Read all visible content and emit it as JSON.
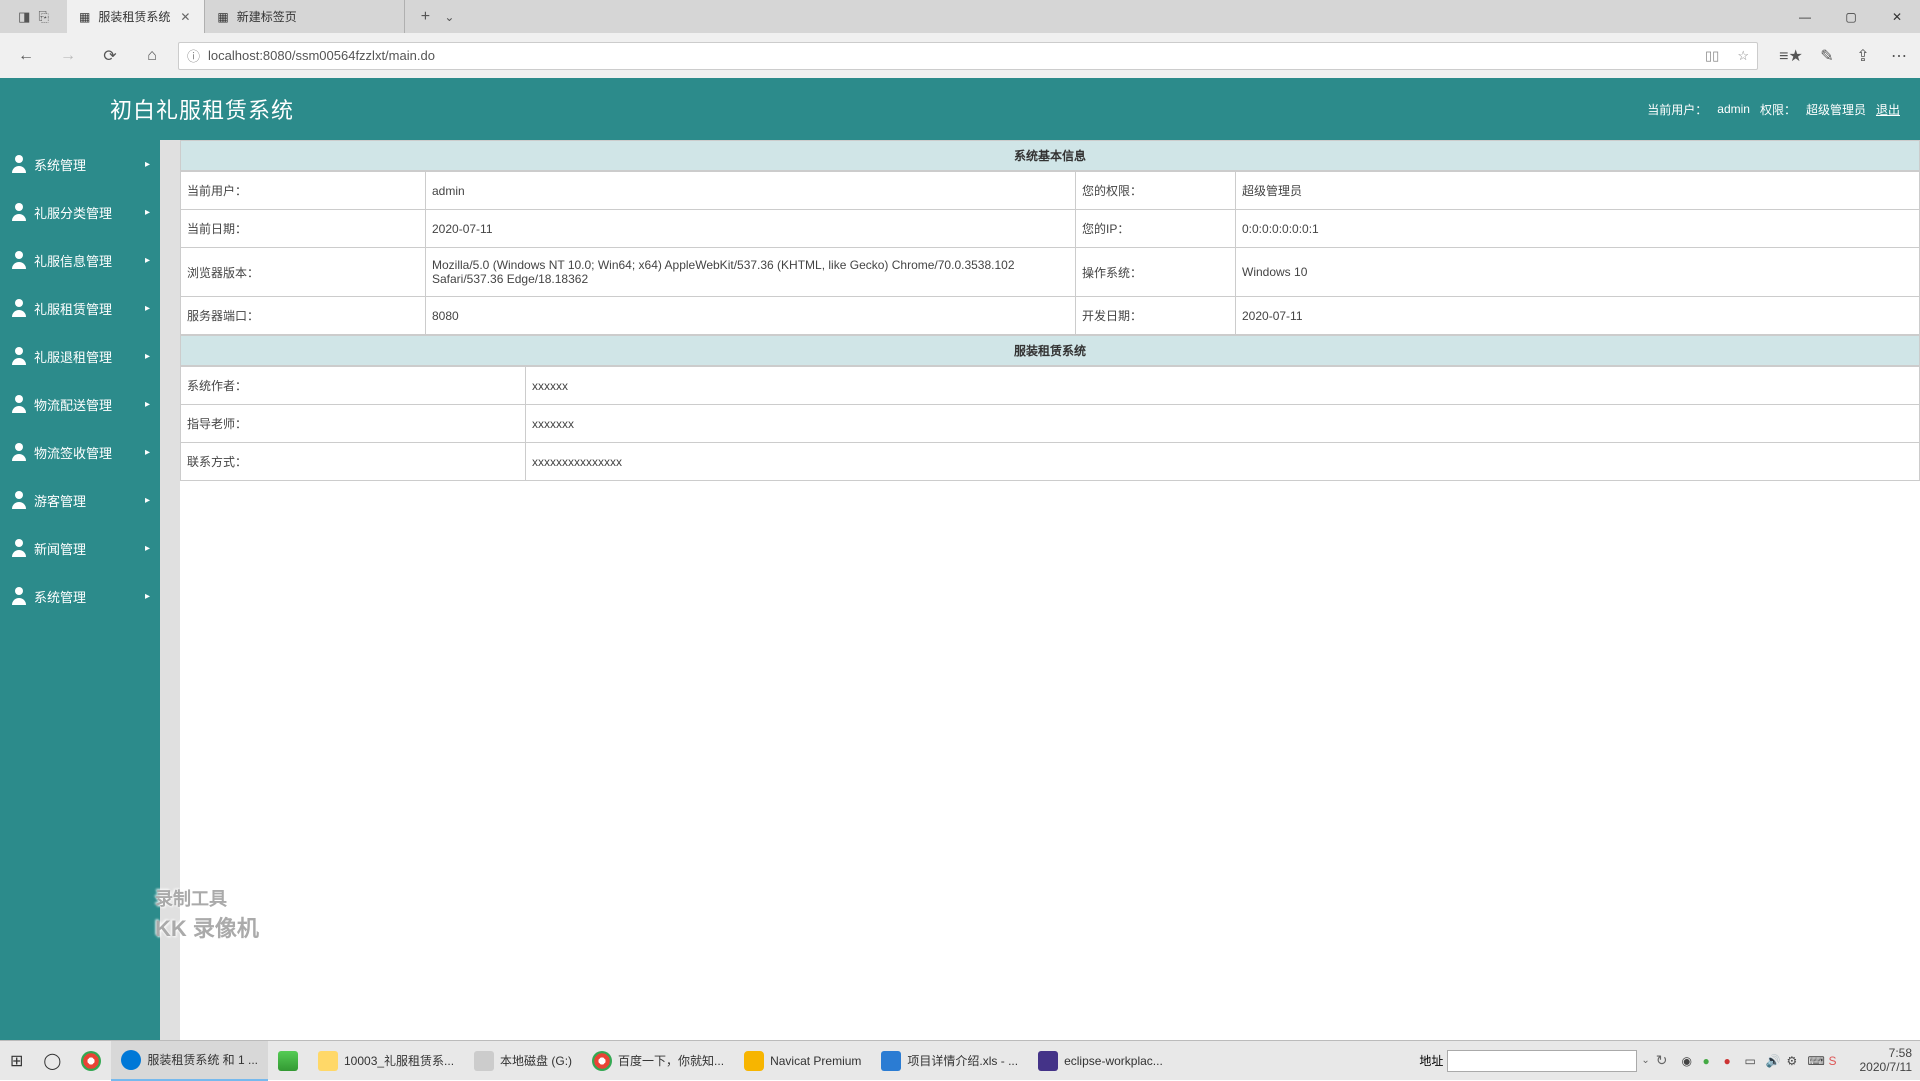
{
  "browser": {
    "tabs": [
      {
        "label": "服装租赁系统",
        "active": true
      },
      {
        "label": "新建标签页",
        "active": false
      }
    ],
    "url": "localhost:8080/ssm00564fzzlxt/main.do",
    "url_prefix_icon": "ⓘ"
  },
  "app": {
    "title": "初白礼服租赁系统",
    "header_user_label": "当前用户：",
    "header_user": "admin",
    "header_role_label": "权限：",
    "header_role": "超级管理员",
    "logout": "退出"
  },
  "sidebar": [
    {
      "label": "系统管理"
    },
    {
      "label": "礼服分类管理"
    },
    {
      "label": "礼服信息管理"
    },
    {
      "label": "礼服租赁管理"
    },
    {
      "label": "礼服退租管理"
    },
    {
      "label": "物流配送管理"
    },
    {
      "label": "物流签收管理"
    },
    {
      "label": "游客管理"
    },
    {
      "label": "新闻管理"
    },
    {
      "label": "系统管理"
    }
  ],
  "panel1": {
    "title": "系统基本信息",
    "rows": [
      {
        "l1": "当前用户：",
        "v1": "admin",
        "l2": "您的权限：",
        "v2": "超级管理员"
      },
      {
        "l1": "当前日期：",
        "v1": "2020-07-11",
        "l2": "您的IP：",
        "v2": "0:0:0:0:0:0:0:1"
      },
      {
        "l1": "浏览器版本：",
        "v1": "Mozilla/5.0 (Windows NT 10.0; Win64; x64) AppleWebKit/537.36 (KHTML, like Gecko) Chrome/70.0.3538.102 Safari/537.36 Edge/18.18362",
        "l2": "操作系统：",
        "v2": "Windows 10"
      },
      {
        "l1": "服务器端口：",
        "v1": "8080",
        "l2": "开发日期：",
        "v2": "2020-07-11"
      }
    ]
  },
  "panel2": {
    "title": "服装租赁系统",
    "rows": [
      {
        "l1": "系统作者：",
        "v1": "xxxxxx"
      },
      {
        "l1": "指导老师：",
        "v1": "xxxxxxx"
      },
      {
        "l1": "联系方式：",
        "v1": "xxxxxxxxxxxxxxx"
      }
    ]
  },
  "watermark": {
    "line1": "录制工具",
    "line2": "KK 录像机"
  },
  "taskbar": {
    "items": [
      {
        "label": "服装租赁系统 和 1 ...",
        "cls": "edge",
        "active": true
      },
      {
        "label": "",
        "cls": "rec",
        "active": false
      },
      {
        "label": "10003_礼服租赁系...",
        "cls": "folder",
        "active": false
      },
      {
        "label": "本地磁盘 (G:)",
        "cls": "disk",
        "active": false
      },
      {
        "label": "百度一下，你就知...",
        "cls": "chrome",
        "active": false
      },
      {
        "label": "Navicat Premium",
        "cls": "navicat",
        "active": false
      },
      {
        "label": "项目详情介绍.xls - ...",
        "cls": "wps",
        "active": false
      },
      {
        "label": "eclipse-workplac...",
        "cls": "eclipse",
        "active": false
      }
    ],
    "addr_label": "地址",
    "time": "7:58",
    "date": "2020/7/11"
  }
}
